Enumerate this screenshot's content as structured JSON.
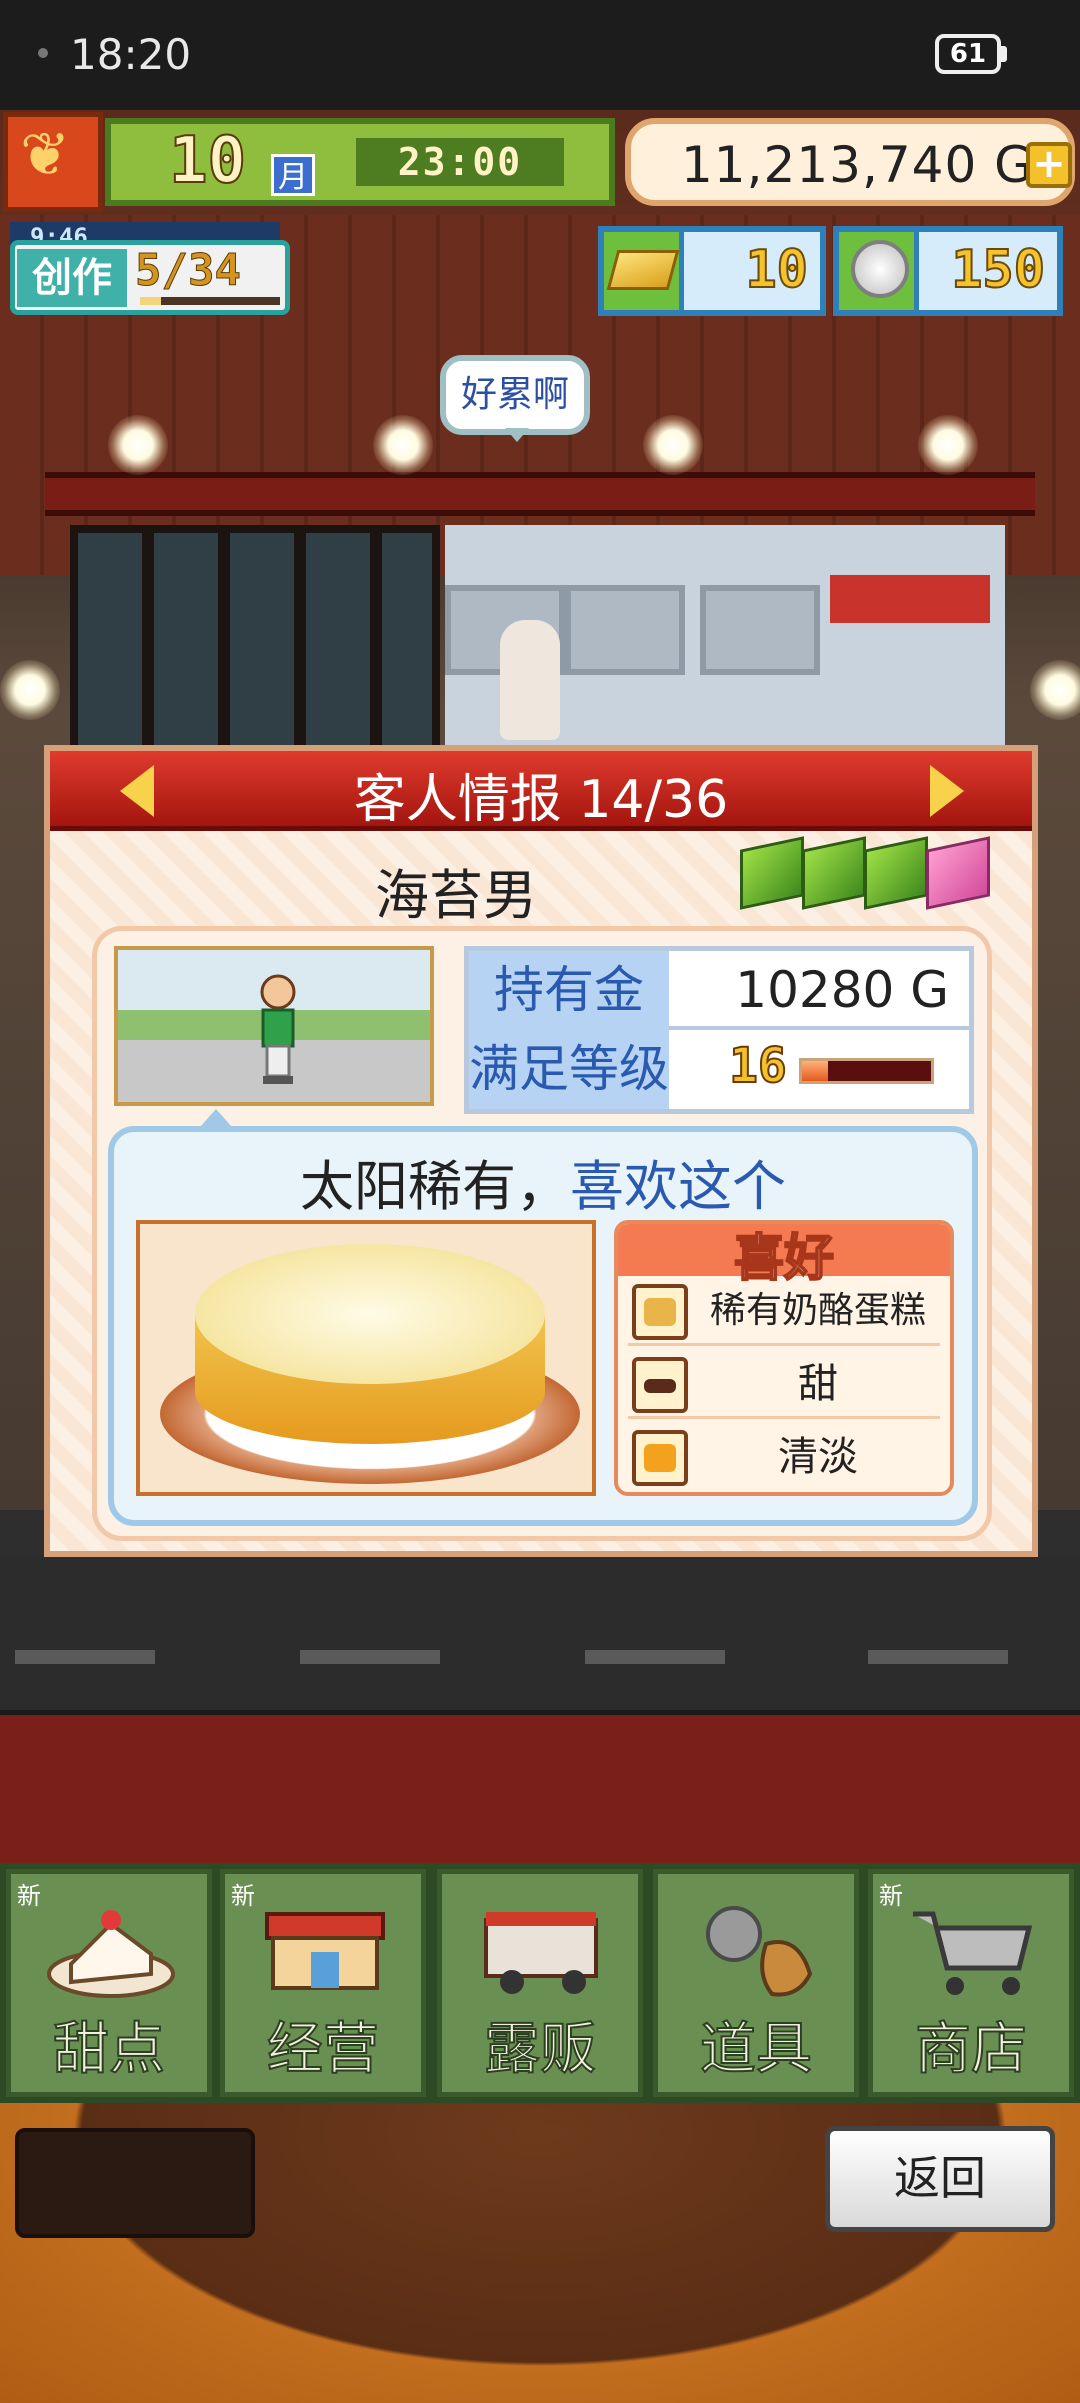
{
  "status_bar": {
    "time": "18:20",
    "battery": "61"
  },
  "top_bar": {
    "month_number": "10",
    "month_unit": "月",
    "clock": "23:00",
    "money": "11,213,740 G",
    "add_button": "+"
  },
  "production": {
    "timer": "9:46",
    "label": "创作",
    "count": "5/34",
    "progress": 0.15
  },
  "resources": {
    "gold_bars": "10",
    "medals": "150"
  },
  "speech_bubble": "好累啊",
  "panel": {
    "title": "客人情报 14/36",
    "customer_name": "海苔男",
    "stats": {
      "money_label": "持有金",
      "money_value": "10280 G",
      "level_label": "满足等级",
      "level_value": "16",
      "level_progress": 0.2
    },
    "preference_text_a": "太阳稀有，",
    "preference_text_b": "喜欢这个",
    "likes_title": "喜好",
    "likes": [
      "稀有奶酪蛋糕",
      "甜",
      "清淡"
    ]
  },
  "menu": [
    {
      "label": "甜点",
      "new": "新"
    },
    {
      "label": "经营",
      "new": "新"
    },
    {
      "label": "露贩",
      "new": ""
    },
    {
      "label": "道具",
      "new": ""
    },
    {
      "label": "商店",
      "new": "新"
    }
  ],
  "back_button": "返回",
  "colors": {
    "accent_red": "#c8261c",
    "panel_bg": "#fbe9d9",
    "highlight_blue": "#2a5ab0"
  }
}
